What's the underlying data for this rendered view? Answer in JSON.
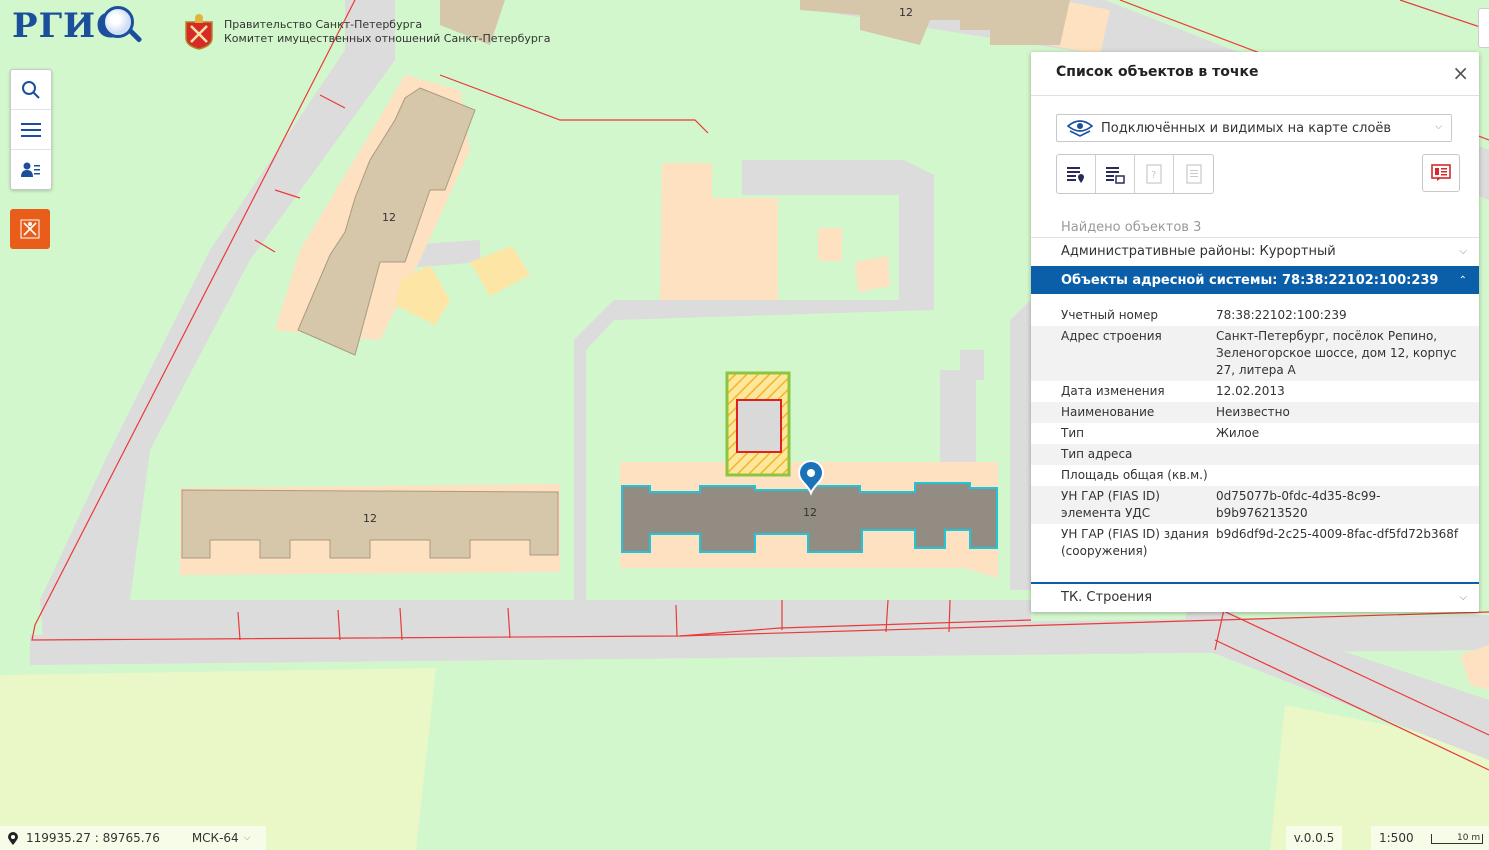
{
  "header": {
    "logo_text": "РГИС",
    "gov_line1": "Правительство Санкт-Петербурга",
    "gov_line2": "Комитет имущественных отношений Санкт-Петербурга"
  },
  "map": {
    "building_labels": [
      "12",
      "12",
      "12",
      "12"
    ]
  },
  "toolbar": {
    "icons": [
      "search-icon",
      "menu-icon",
      "user-list-icon"
    ],
    "district_icon": "spb-coat-icon"
  },
  "panel": {
    "title": "Список объектов в точке",
    "close_label": "×",
    "layer_select": "Подключённых и видимых на карте слоёв",
    "found": "Найдено объектов 3",
    "sections": [
      {
        "label": "Административные районы: Курортный",
        "expanded": false
      },
      {
        "label": "Объекты адресной системы: 78:38:22102:100:239",
        "expanded": true
      },
      {
        "label": "ТК. Строения",
        "expanded": false
      }
    ],
    "attributes": [
      {
        "key": "Учетный номер",
        "value": "78:38:22102:100:239"
      },
      {
        "key": "Адрес строения",
        "value": "Санкт-Петербург, посёлок Репино, Зеленогорское шоссе, дом 12, корпус 27, литера А"
      },
      {
        "key": "Дата изменения",
        "value": "12.02.2013"
      },
      {
        "key": "Наименование",
        "value": "Неизвестно"
      },
      {
        "key": "Тип",
        "value": "Жилое"
      },
      {
        "key": "Тип адреса",
        "value": ""
      },
      {
        "key": "Площадь общая (кв.м.)",
        "value": ""
      },
      {
        "key": "УН ГАР (FIAS ID) элемента УДС",
        "value": "0d75077b-0fdc-4d35-8c99-b9b976213520"
      },
      {
        "key": "УН ГАР (FIAS ID) здания (сооружения)",
        "value": "b9d6df9d-2c25-4009-8fac-df5fd72b368f"
      }
    ],
    "accent_color": "#0b5fa8"
  },
  "footer": {
    "coordinates": "119935.27 : 89765.76",
    "crs": "МСК-64",
    "version": "v.0.0.5",
    "scale": "1:500",
    "scale_bar": "10 m"
  }
}
